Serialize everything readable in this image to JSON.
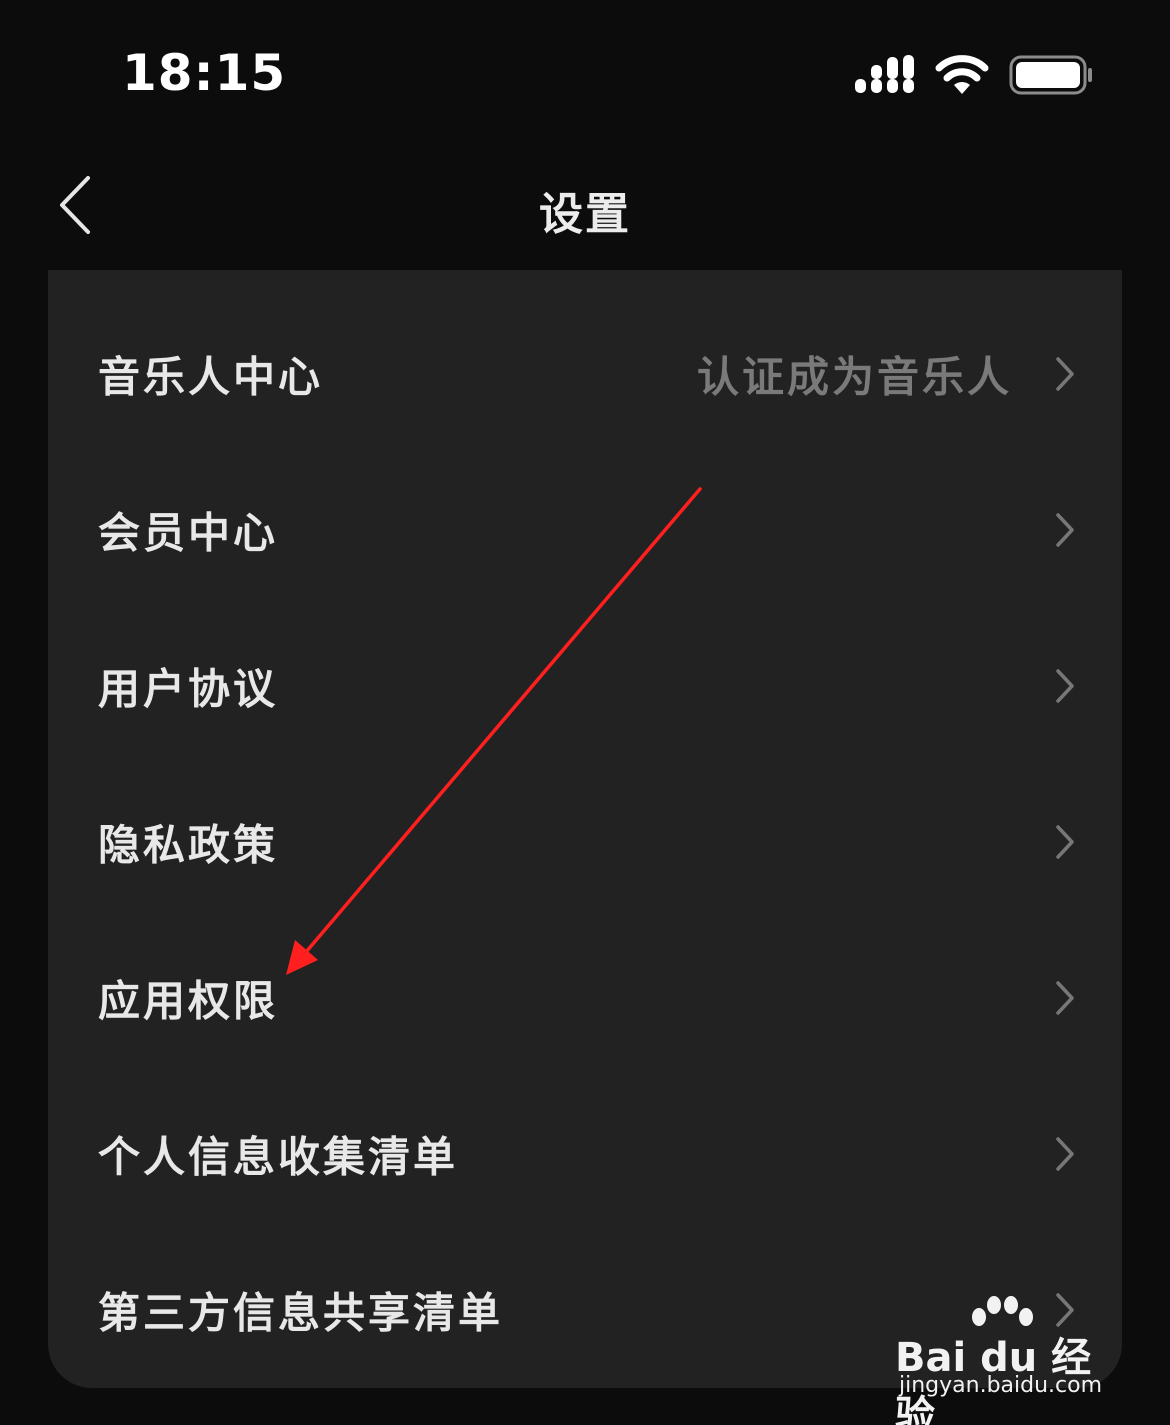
{
  "status_bar": {
    "time": "18:15",
    "icons": [
      "signal-icon",
      "wifi-icon",
      "battery-icon"
    ]
  },
  "nav": {
    "title": "设置",
    "back_icon": "back-chevron-icon"
  },
  "settings": {
    "items": [
      {
        "label": "音乐人中心",
        "value": "认证成为音乐人"
      },
      {
        "label": "会员中心",
        "value": ""
      },
      {
        "label": "用户协议",
        "value": ""
      },
      {
        "label": "隐私政策",
        "value": ""
      },
      {
        "label": "应用权限",
        "value": ""
      },
      {
        "label": "个人信息收集清单",
        "value": ""
      },
      {
        "label": "第三方信息共享清单",
        "value": ""
      }
    ]
  },
  "watermark": {
    "brand": "Bai du 经验",
    "url": "jingyan.baidu.com"
  },
  "colors": {
    "background": "#0c0c0c",
    "card": "#222222",
    "label": "#e8e8e8",
    "secondary": "#7a7a7a",
    "annotation": "#ff1f1f"
  }
}
